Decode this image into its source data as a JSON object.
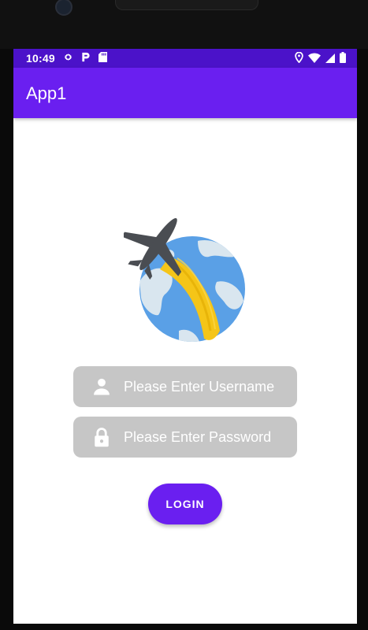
{
  "status_bar": {
    "time": "10:49",
    "left_icons": [
      "gear-icon",
      "parking-p-icon",
      "sd-card-icon"
    ],
    "right_icons": [
      "location-pin-icon",
      "wifi-icon",
      "signal-icon",
      "battery-icon"
    ]
  },
  "app_bar": {
    "title": "App1"
  },
  "logo": {
    "icon": "airplane-globe-logo"
  },
  "login_form": {
    "username": {
      "placeholder": "Please Enter Username",
      "icon": "person-icon"
    },
    "password": {
      "placeholder": "Please Enter Password",
      "icon": "lock-icon"
    },
    "login_label": "LOGIN"
  },
  "colors": {
    "primary": "#6a1ff0",
    "status_bar": "#4b12c9",
    "field_bg": "#c6c6c6",
    "globe_ocean": "#5aa0e6",
    "globe_land": "#d9e6ef",
    "trail_yellow": "#f5c518",
    "plane_gray": "#4a4d52"
  }
}
